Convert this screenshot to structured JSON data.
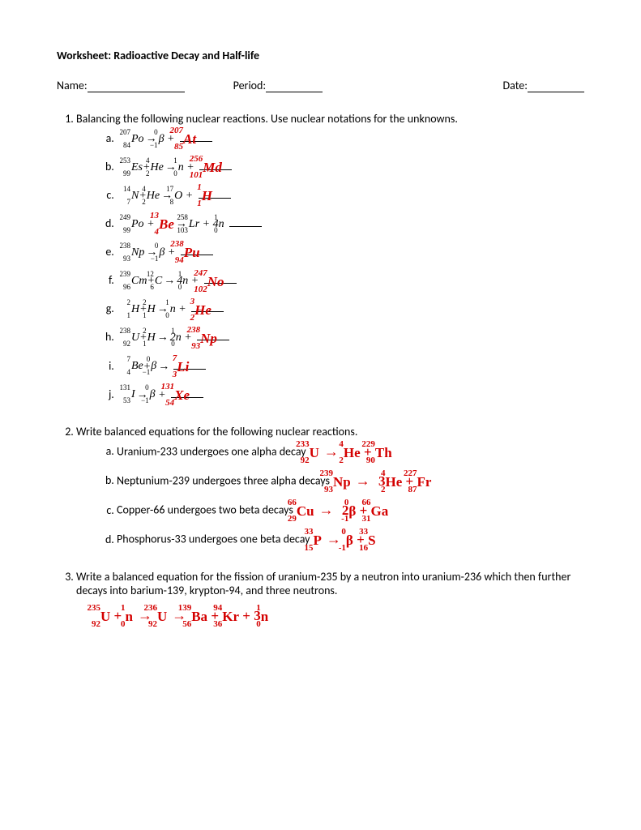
{
  "title": "Worksheet: Radioactive Decay and Half-life",
  "header": {
    "name_label": "Name:",
    "period_label": "Period:",
    "date_label": "Date:"
  },
  "q1": {
    "prompt": "Balancing the following nuclear reactions.  Use nuclear notations for the unknowns.",
    "items": [
      {
        "eq_html": "<span class='nuc'><span class='mass'>207</span><span class='atom'>84</span>Po</span><span class='arrow'>→</span><span class='nuc'><span class='mass'>0</span><span class='atom'>−1</span>β</span> + ",
        "ans_mass": "207",
        "ans_atom": "85",
        "ans_sym": "At"
      },
      {
        "eq_html": "<span class='nuc'><span class='mass'>253</span><span class='atom'>99</span>Es</span>+<span class='nuc'><span class='mass'>4</span><span class='atom'>2</span>He</span><span class='arrow'>→</span><span class='nuc'><span class='mass'>1</span><span class='atom'>0</span>n</span> + ",
        "ans_mass": "256",
        "ans_atom": "101",
        "ans_sym": "Md"
      },
      {
        "eq_html": "<span class='nuc'><span class='mass'>14</span><span class='atom'>7</span>N</span>+<span class='nuc'><span class='mass'>4</span><span class='atom'>2</span>He</span><span class='arrow'>→</span><span class='nuc'><span class='mass'>17</span><span class='atom'>8</span>O</span> + ",
        "ans_mass": "1",
        "ans_atom": "1",
        "ans_sym": "H"
      },
      {
        "eq_html": "<span class='nuc'><span class='mass'>249</span><span class='atom'>99</span>Po</span> + <span class='ublank'></span><span class='arrow'>→</span><span class='nuc'><span class='mass'>258</span><span class='atom'>103</span>Lr</span> + 4<span class='nuc'><span class='mass'>1</span><span class='atom'>0</span>n</span> <span class='ublank'></span>",
        "ans_mass": "13",
        "ans_atom": "4",
        "ans_sym": "Be",
        "ans_after_first": true
      },
      {
        "eq_html": "<span class='nuc'><span class='mass'>238</span><span class='atom'>93</span>Np</span><span class='arrow'>→</span><span class='nuc'><span class='mass'>0</span><span class='atom'>−1</span>β</span> + ",
        "ans_mass": "238",
        "ans_atom": "94",
        "ans_sym": "Pu"
      },
      {
        "eq_html": "<span class='nuc'><span class='mass'>239</span><span class='atom'>96</span>Cm</span>+<span class='nuc'><span class='mass'>12</span><span class='atom'>6</span>C</span><span class='arrow'>→</span>4<span class='nuc'><span class='mass'>1</span><span class='atom'>0</span>n</span> + ",
        "ans_mass": "247",
        "ans_atom": "102",
        "ans_sym": "No"
      },
      {
        "eq_html": "<span class='nuc'><span class='mass'>2</span><span class='atom'>1</span>H</span>+<span class='nuc'><span class='mass'>2</span><span class='atom'>1</span>H</span><span class='arrow'>→</span><span class='nuc'><span class='mass'>1</span><span class='atom'>0</span>n</span> + ",
        "ans_mass": "3",
        "ans_atom": "2",
        "ans_sym": "He"
      },
      {
        "eq_html": "<span class='nuc'><span class='mass'>238</span><span class='atom'>92</span>U</span>+<span class='nuc'><span class='mass'>2</span><span class='atom'>1</span>H</span><span class='arrow'>→</span>2<span class='nuc'><span class='mass'>1</span><span class='atom'>0</span>n</span> + ",
        "ans_mass": "238",
        "ans_atom": "93",
        "ans_sym": "Np"
      },
      {
        "eq_html": "<span class='nuc'><span class='mass'>7</span><span class='atom'>4</span>Be</span>+<span class='nuc'><span class='mass'>0</span><span class='atom'>−1</span>β</span><span class='arrow'>→</span>",
        "ans_mass": "7",
        "ans_atom": "3",
        "ans_sym": "Li"
      },
      {
        "eq_html": "<span class='nuc'><span class='mass'>131</span><span class='atom'>53</span>I</span><span class='arrow'>→</span><span class='nuc'><span class='mass'>0</span><span class='atom'>−1</span>β</span> + ",
        "ans_mass": "131",
        "ans_atom": "54",
        "ans_sym": "Xe"
      }
    ]
  },
  "q2": {
    "prompt": "Write balanced equations for the following nuclear reactions.",
    "items": [
      {
        "text": "Uranium-233 undergoes one alpha decay",
        "ans_html": "<span class='hw-nuc'><span class='hm'>233</span><span class='ha'>92</span>U</span><span class='bigarrow'>→</span><span class='hw-nuc'><span class='hm'>4</span><span class='ha'>2</span>He</span> + <span class='hw-nuc'><span class='hm'>229</span><span class='ha'>90</span>Th</span>"
      },
      {
        "text": "Neptunium-239 undergoes three alpha decays",
        "ans_html": "<span class='hw-nuc'><span class='hm'>239</span><span class='ha'>93</span>Np</span><span class='bigarrow'>→</span> 3<span class='hw-nuc'><span class='hm'>4</span><span class='ha'>2</span>He</span> + <span class='hw-nuc'><span class='hm'>227</span><span class='ha'>87</span>Fr</span>"
      },
      {
        "text": "Copper-66 undergoes two beta decays",
        "ans_html": "<span class='hw-nuc'><span class='hm'>66</span><span class='ha'>29</span>Cu</span><span class='bigarrow'>→</span> 2<span class='hw-nuc'><span class='hm'>0</span><span class='ha'>-1</span>β</span> + <span class='hw-nuc'><span class='hm'>66</span><span class='ha'>31</span>Ga</span>"
      },
      {
        "text": "Phosphorus-33 undergoes one beta decay",
        "ans_html": "<span class='hw-nuc'><span class='hm'>33</span><span class='ha'>15</span>P</span><span class='bigarrow'>→</span><span class='hw-nuc'><span class='hm'>0</span><span class='ha'>-1</span>β</span> + <span class='hw-nuc'><span class='hm'>33</span><span class='ha'>16</span>S</span>"
      }
    ]
  },
  "q3": {
    "prompt": "Write a balanced equation for the fission of uranium-235 by a neutron into uranium-236 which then further decays into barium-139, krypton-94, and three neutrons.",
    "ans_html": "<span class='hw-nuc'><span class='hm'>235</span><span class='ha'>92</span>U</span> + <span class='hw-nuc'><span class='hm'>1</span><span class='ha'>0</span>n</span><span class='bigarrow'>→</span><span class='hw-nuc'><span class='hm'>236</span><span class='ha'>92</span>U</span><span class='bigarrow'>→</span><span class='hw-nuc'><span class='hm'>139</span><span class='ha'>56</span>Ba</span> + <span class='hw-nuc'><span class='hm'>94</span><span class='ha'>36</span>Kr</span> + 3<span class='hw-nuc'><span class='hm'>1</span><span class='ha'>0</span>n</span>"
  }
}
